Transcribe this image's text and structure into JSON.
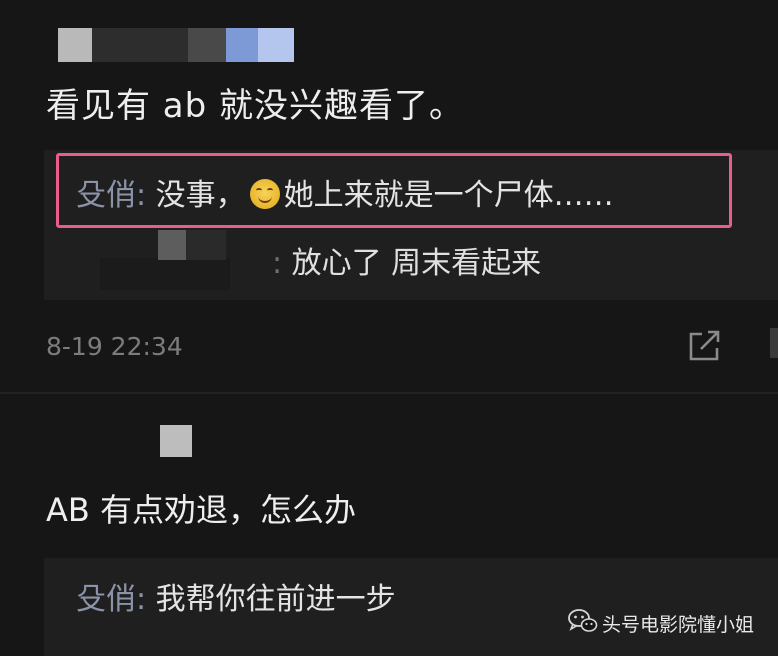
{
  "comment1": {
    "text": "看见有 ab 就没兴趣看了。",
    "replies": [
      {
        "name": "殳俏",
        "colon": ":",
        "body_before": " 没事，",
        "body_after": "她上来就是一个尸体……"
      },
      {
        "colon": ":",
        "body": " 放心了  周末看起来"
      }
    ],
    "time": "8-19 22:34"
  },
  "comment2": {
    "text": "AB 有点劝退，怎么办",
    "reply": {
      "name": "殳俏",
      "colon": ":",
      "body": " 我帮你往前进一步"
    }
  },
  "watermark": {
    "text": "头号电影院懂小姐"
  },
  "icons": {
    "emoji": "smiling-emoji-icon",
    "share": "share-icon",
    "wechat": "wechat-icon"
  },
  "colors": {
    "highlight": "#e85d8a",
    "username": "#8a93a8",
    "background": "#161616"
  }
}
